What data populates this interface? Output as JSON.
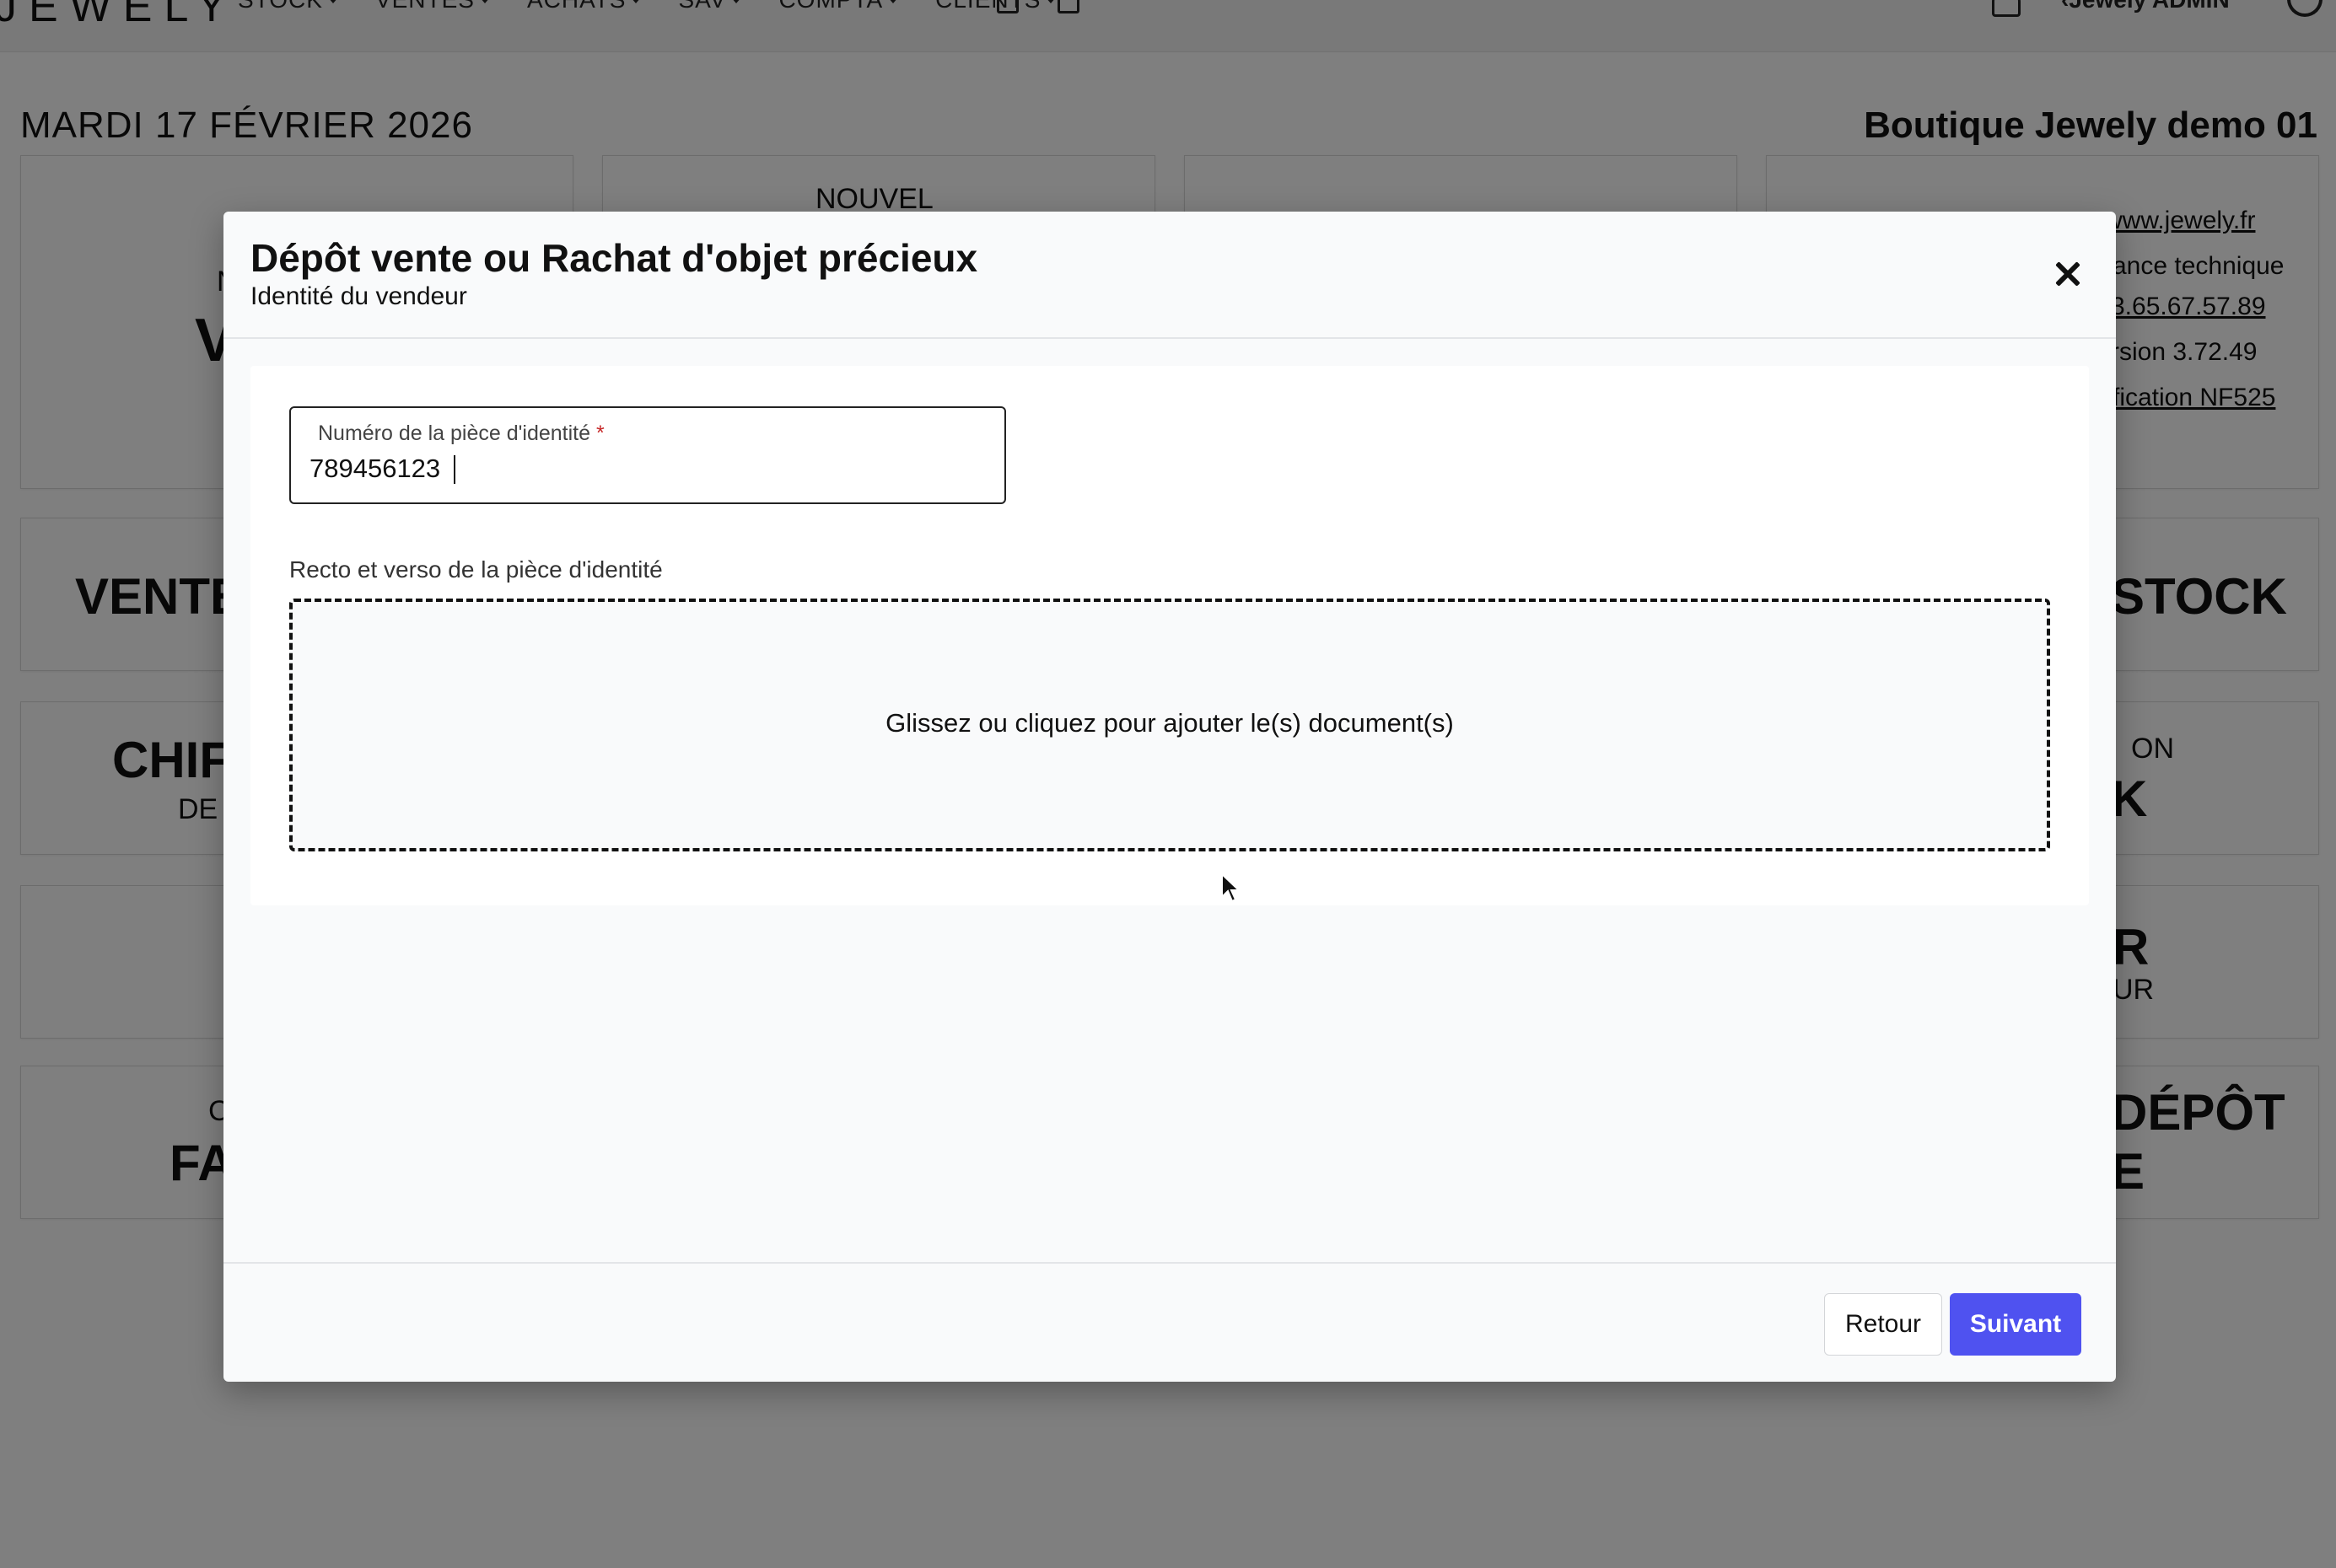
{
  "app": {
    "logo": "JEWELY",
    "nav": [
      "STOCK",
      "VENTES",
      "ACHATS",
      "SAV",
      "COMPTA",
      "CLIENTS"
    ],
    "user": "Jewely ADMIN",
    "date": "MARDI 17 FÉVRIER 2026",
    "shop": "Boutique Jewely demo 01",
    "tiles": {
      "nouvel": "NOUVEL",
      "vente_letter": "V",
      "vente_small": "N",
      "ventes": "VENTE",
      "stock": "STOCK",
      "chif": "CHIF",
      "chif_sub": "DE",
      "on_label": "ON",
      "k_label": "K",
      "r_label": "R",
      "ur_label": "UR",
      "fa": "FA",
      "c_label": "C",
      "depot": "DÉPÔT",
      "e_label": "E"
    },
    "info": {
      "website": "www.jewely.fr",
      "assistance": "ance technique",
      "phone": "3.65.67.57.89",
      "version": "rsion 3.72.49",
      "certification": "fication NF525"
    }
  },
  "modal": {
    "title": "Dépôt vente ou Rachat d'objet précieux",
    "subtitle": "Identité du vendeur",
    "id_field": {
      "label": "Numéro de la pièce d'identité",
      "required_mark": "*",
      "value": "789456123"
    },
    "upload": {
      "label": "Recto et verso de la pièce d'identité",
      "dropzone_text": "Glissez ou cliquez pour ajouter le(s) document(s)"
    },
    "buttons": {
      "back": "Retour",
      "next": "Suivant"
    }
  },
  "colors": {
    "primary": "#4f52f0",
    "required": "#c62828"
  }
}
